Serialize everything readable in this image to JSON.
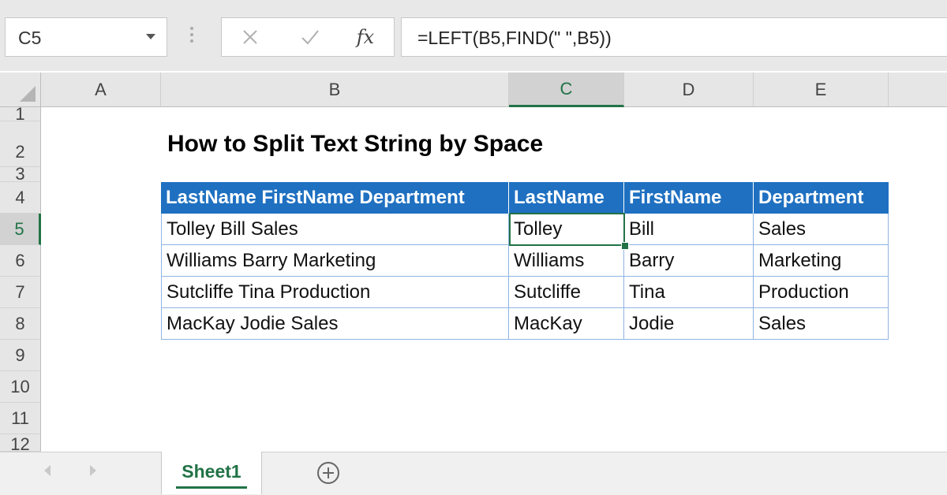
{
  "formula_bar": {
    "name_box": "C5",
    "cancel_icon": "x-icon",
    "enter_icon": "check-icon",
    "function_icon_label": "fx",
    "formula": "=LEFT(B5,FIND(\" \",B5))"
  },
  "columns": [
    "A",
    "B",
    "C",
    "D",
    "E"
  ],
  "rows": [
    "1",
    "2",
    "3",
    "4",
    "5",
    "6",
    "7",
    "8",
    "9",
    "10",
    "11",
    "12"
  ],
  "selected_cell": "C5",
  "sheet": {
    "title": "How to Split Text String by Space",
    "table": {
      "headers": [
        "LastName FirstName Department",
        "LastName",
        "FirstName",
        "Department"
      ],
      "rows": [
        [
          "Tolley Bill Sales",
          "Tolley",
          "Bill",
          "Sales"
        ],
        [
          "Williams Barry Marketing",
          "Williams",
          "Barry",
          "Marketing"
        ],
        [
          "Sutcliffe Tina Production",
          "Sutcliffe",
          "Tina",
          "Production"
        ],
        [
          "MacKay Jodie Sales",
          "MacKay",
          "Jodie",
          "Sales"
        ]
      ]
    }
  },
  "tabs": {
    "active": "Sheet1"
  },
  "colors": {
    "excel_green": "#217346",
    "table_header_blue": "#1f70c1"
  }
}
